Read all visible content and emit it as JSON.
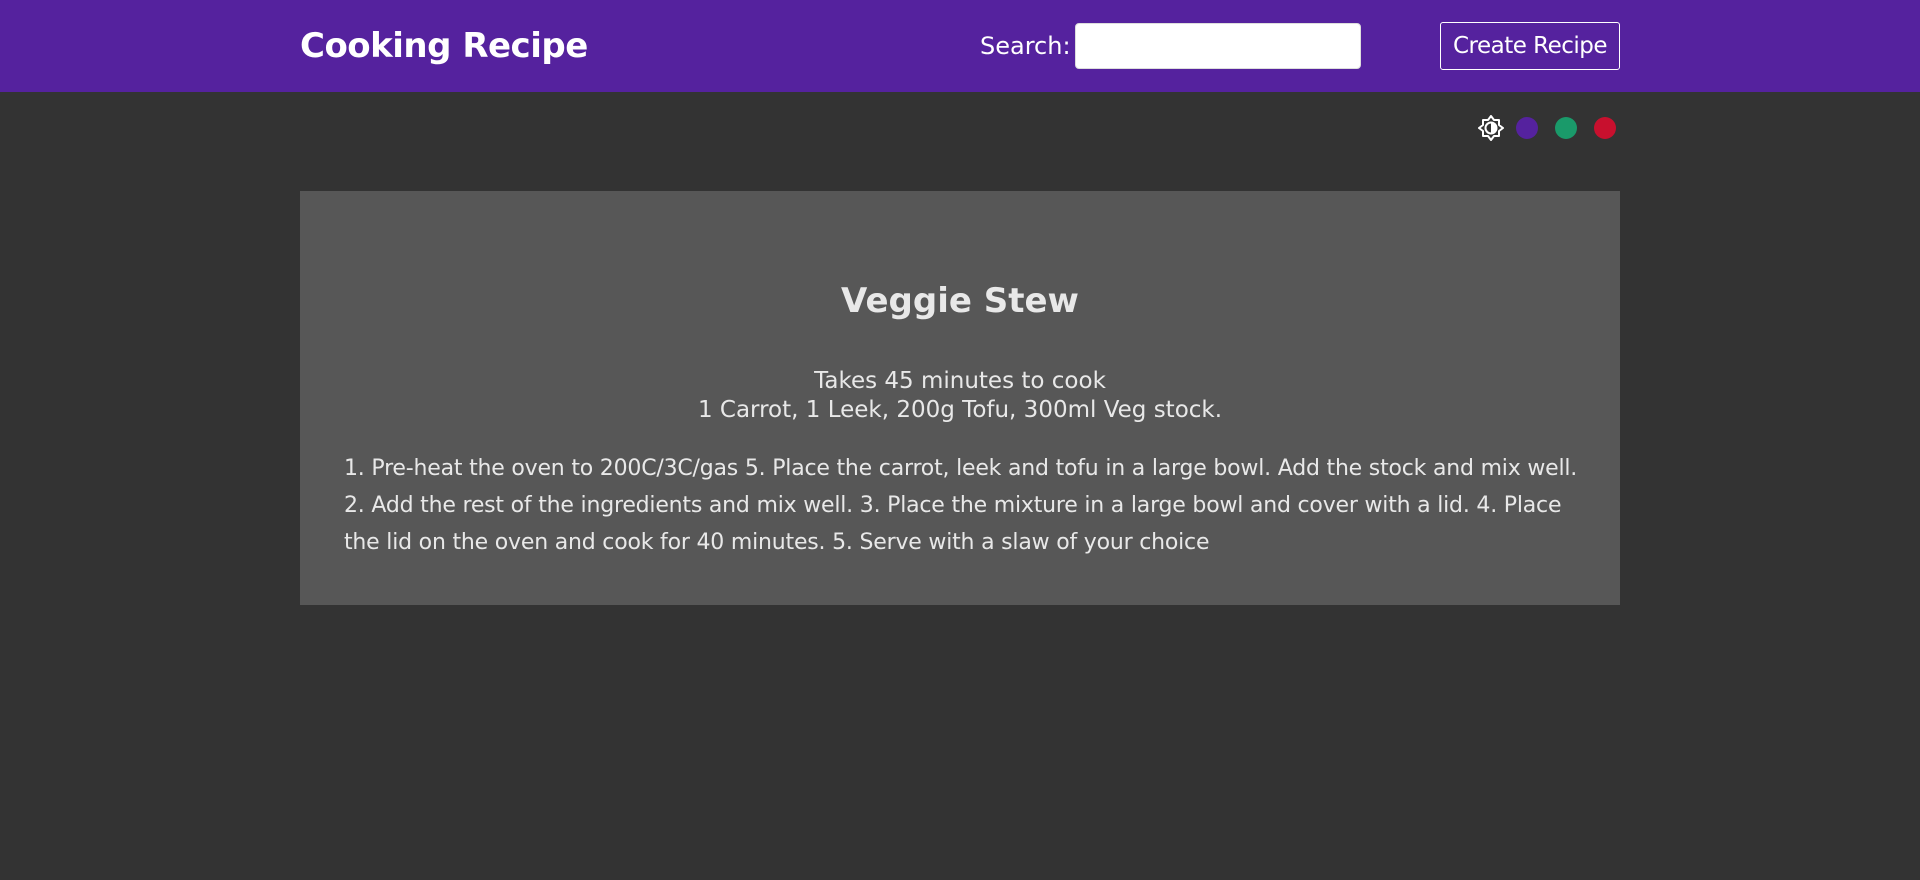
{
  "header": {
    "brand": "Cooking Recipe",
    "search_label": "Search:",
    "search_value": "",
    "search_placeholder": "",
    "create_button_label": "Create Recipe"
  },
  "theme": {
    "contrast_icon": "contrast-toggle-icon",
    "swatches": [
      {
        "name": "purple",
        "color": "#55229e"
      },
      {
        "name": "green",
        "color": "#1a9a6a"
      },
      {
        "name": "red",
        "color": "#c8102e"
      }
    ]
  },
  "recipe": {
    "title": "Veggie Stew",
    "cook_time": "Takes 45 minutes to cook",
    "ingredients": "1 Carrot,  1 Leek,  200g Tofu,  300ml Veg stock.",
    "method": "1. Pre-heat the oven to 200C/3C/gas 5. Place the carrot, leek and tofu in a large bowl. Add the stock and mix well. 2. Add the rest of the ingredients and mix well. 3. Place the mixture in a large bowl and cover with a lid. 4. Place the lid on the oven and cook for 40 minutes. 5. Serve with a slaw of your choice"
  }
}
